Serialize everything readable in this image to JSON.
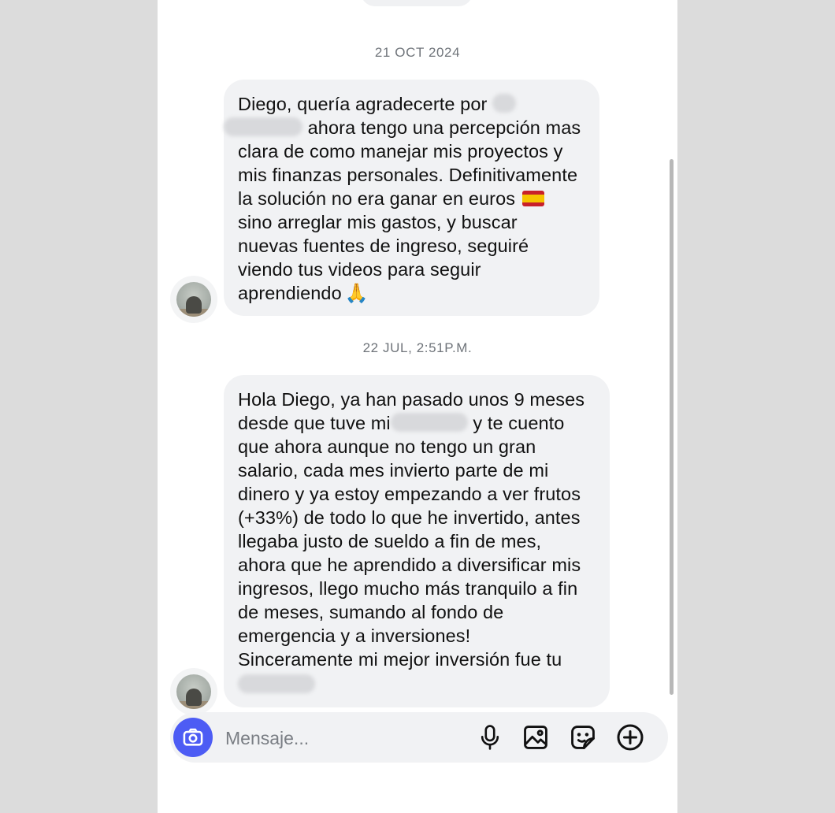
{
  "messages": [
    {
      "timestamp": "21 OCT 2024",
      "parts": {
        "a": "Diego, quería agradecerte por",
        "b": "ahora tengo una percepción mas clara de como manejar mis proyectos y mis finanzas personales. Definitivamente la solución no era ganar en euros",
        "c": "sino arreglar mis gastos, y buscar nuevas fuentes de ingreso, seguiré viendo tus videos para seguir aprendiendo"
      }
    },
    {
      "timestamp": "22 JUL, 2:51P.M.",
      "parts": {
        "a": "Hola Diego, ya han pasado unos 9 meses desde que tuve mi",
        "b": "y te cuento que ahora aunque no tengo un gran salario, cada mes invierto parte de mi dinero y ya estoy empezando a ver frutos (+33%) de todo lo que he invertido, antes llegaba justo de sueldo a fin de mes, ahora que he aprendido a diversificar mis ingresos, llego mucho más tranquilo a fin de meses, sumando al fondo de emergencia y a inversiones!",
        "c": "Sinceramente mi mejor inversión fue tu"
      }
    }
  ],
  "emoji": {
    "flag": "spain-flag",
    "pray": "🙏"
  },
  "composer": {
    "placeholder": "Mensaje..."
  },
  "icons": {
    "camera": "camera-icon",
    "mic": "microphone-icon",
    "gallery": "image-icon",
    "sticker": "sticker-icon",
    "add": "plus-circle-icon"
  }
}
